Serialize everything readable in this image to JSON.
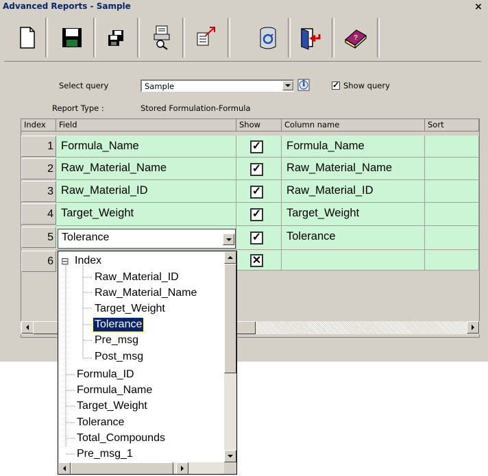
{
  "window": {
    "title": "Advanced Reports - Sample",
    "close_glyph": "×"
  },
  "toolbar": {
    "buttons": [
      {
        "name": "new-icon"
      },
      {
        "name": "save-icon"
      },
      {
        "name": "save-as-icon"
      },
      {
        "name": "print-preview-icon"
      },
      {
        "name": "export-icon"
      },
      {
        "name": "database-icon"
      },
      {
        "name": "exit-icon"
      },
      {
        "name": "help-book-icon"
      }
    ]
  },
  "query": {
    "select_label": "Select query",
    "selected": "Sample",
    "info_glyph": "i",
    "show_query_label": "Show query",
    "show_query_checked": "✓",
    "report_type_label": "Report Type :",
    "report_type_value": "Stored Formulation-Formula"
  },
  "grid": {
    "headers": {
      "index": "Index",
      "field": "Field",
      "show": "Show",
      "column": "Column name",
      "sort": "Sort"
    },
    "rows": [
      {
        "index": "1",
        "field": "Formula_Name",
        "show": "✓",
        "column": "Formula_Name"
      },
      {
        "index": "2",
        "field": "Raw_Material_Name",
        "show": "✓",
        "column": "Raw_Material_Name"
      },
      {
        "index": "3",
        "field": "Raw_Material_ID",
        "show": "✓",
        "column": "Raw_Material_ID"
      },
      {
        "index": "4",
        "field": "Target_Weight",
        "show": "✓",
        "column": "Target_Weight"
      },
      {
        "index": "5",
        "field": "Tolerance",
        "show": "✓",
        "column": "Tolerance"
      },
      {
        "index": "6",
        "field": "",
        "show": "✕",
        "column": ""
      }
    ]
  },
  "dropdown": {
    "expander": "⊟",
    "group": "Index",
    "children": [
      "Raw_Material_ID",
      "Raw_Material_Name",
      "Target_Weight",
      "Tolerance",
      "Pre_msg",
      "Post_msg"
    ],
    "selected": "Tolerance",
    "items": [
      "Formula_ID",
      "Formula_Name",
      "Target_Weight",
      "Tolerance",
      "Total_Compounds",
      "Pre_msg_1"
    ]
  },
  "colors": {
    "row_bg": "#ccf5d6",
    "selected_bg": "#0a246a",
    "window_bg": "#d4d0c8"
  }
}
